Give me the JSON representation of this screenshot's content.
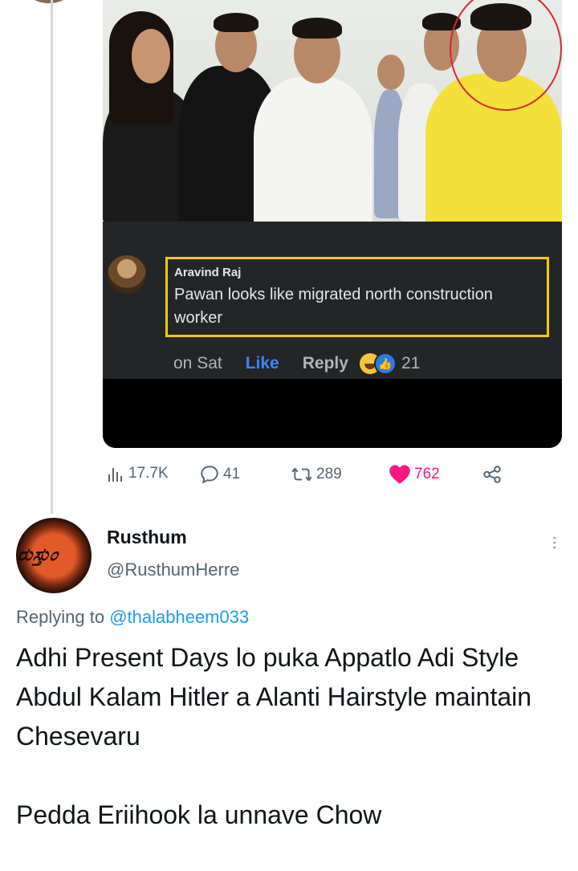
{
  "embedded_image": {
    "commenter_name": "Aravind Raj",
    "comment_text": "Pawan looks like migrated north construction worker",
    "time": "on Sat",
    "like_label": "Like",
    "reply_label": "Reply",
    "reaction_count": "21"
  },
  "stats": {
    "views": "17.7K",
    "replies": "41",
    "retweets": "289",
    "likes": "762"
  },
  "reply_tweet": {
    "display_name": "Rusthum",
    "handle": "@RusthumHerre",
    "replying_prefix": "Replying to",
    "replying_to": "@thalabheem033",
    "lines": [
      "Adhi Present Days lo puka Appatlo Adi Style",
      "Abdul Kalam Hitler a Alanti Hairstyle maintain Chesevaru",
      "",
      "Pedda Eriihook la unnave Chow"
    ],
    "more_icon": "more-vertical-icon"
  },
  "colors": {
    "like_pink": "#f91880",
    "link_blue": "#1d9bf0",
    "highlight_yellow": "#f2c811",
    "annotation_red": "#d6292e"
  }
}
